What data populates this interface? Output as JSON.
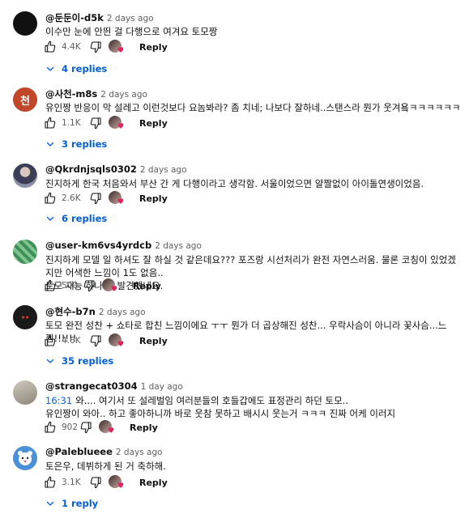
{
  "reply_label": "Reply",
  "comments": [
    {
      "author": "@둔둔이-d5k",
      "time": "2 days ago",
      "text": "이수만 눈에 안띈 걸 다행으로 여겨요 토모짱",
      "likes": "4.4K",
      "replies": "4 replies",
      "avatar": {
        "kind": "dark",
        "color": "#111111"
      }
    },
    {
      "author": "@사천-m8s",
      "time": "2 days ago",
      "text": "유인짱 반응이 막 설레고 이런것보다 요놈봐라? 좀 치네; 나보다 잘하네..스탠스라 뭔가 웃겨욬ㅋㅋㅋㅋㅋㅋ",
      "likes": "1.1K",
      "replies": "3 replies",
      "avatar": {
        "kind": "letter",
        "letter": "천",
        "color": "#c0472a"
      }
    },
    {
      "author": "@Qkrdnjsqls0302",
      "time": "2 days ago",
      "text": "진지하게 한국 처음와서 부산 간 게 다행이라고 생각함. 서울이었으면 얄짤없이 아이돌연생이었음.",
      "likes": "2.6K",
      "replies": "6 replies",
      "avatar": {
        "kind": "photo",
        "color": "#6b6f86"
      }
    },
    {
      "author": "@user-km6vs4yrdcb",
      "time": "2 days ago",
      "text_lines": [
        "진지하게 모델 일 하셔도 잘 하실 것 같은데요??? 포즈랑 시선처리가 완전 자연스러움. 물론 코칭이 있었겠지만 어색한 느낌이 1도 없음..",
        "토모 재능 하나 더 발견했네요."
      ],
      "likes": "500",
      "replies": "",
      "avatar": {
        "kind": "pattern",
        "color": "#3f8f5a"
      }
    },
    {
      "author": "@현수-b7n",
      "time": "2 days ago",
      "text": "토모 완전 성찬 + 쇼타로 합친 느낌이에요 ㅜㅜ 뭔가 더 곱상해진 성찬... 우락사슴이 아니라 꽃사슴...느낌!!!!!!",
      "likes": "4.6K",
      "replies": "35 replies",
      "avatar": {
        "kind": "cat",
        "color": "#1a1a1a"
      }
    },
    {
      "author": "@strangecat0304",
      "time": "1 day ago",
      "timestamp": "16:31",
      "text_lines": [
        "와.... 여기서 또 설레벌임  여러분들의 호들갑에도 표정관리 하던 토모..",
        "유인짱이 와아.. 하고 좋아하니까 바로 웃참 못하고 배시시 웃는거 ㅋㅋㅋ 진짜 어케 이러지"
      ],
      "likes": "902",
      "replies": "",
      "avatar": {
        "kind": "photo2",
        "color": "#b9b3a5"
      }
    },
    {
      "author": "@Paleblueee",
      "time": "2 days ago",
      "text": "토은우, 데뷔하게 된 거 축하해.",
      "likes": "3.1K",
      "replies": "1 reply",
      "avatar": {
        "kind": "bear",
        "color": "#4a90d9"
      }
    }
  ],
  "colors": {
    "link": "#065fd4",
    "meta": "#606060",
    "text": "#0f0f0f"
  }
}
